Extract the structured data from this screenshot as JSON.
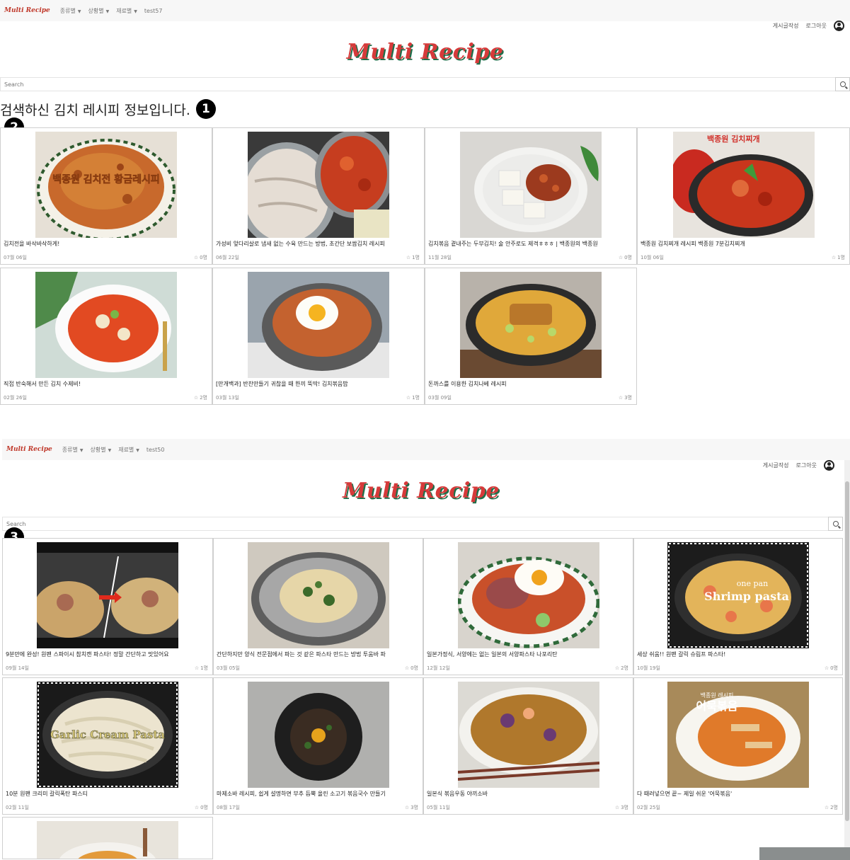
{
  "screen1": {
    "nav": {
      "brand": "Multi Recipe",
      "menu": [
        "종류별",
        "상황별",
        "재료별"
      ],
      "user": "test57"
    },
    "topright": {
      "write_label": "게시글작성",
      "logout_label": "로그아웃"
    },
    "logo": "Multi Recipe",
    "search": {
      "placeholder": "Search"
    },
    "result_heading": "검색하신 김치 레시피 정보입니다.",
    "markers": [
      "1",
      "2"
    ],
    "cards": [
      {
        "title": "김치전을 바삭바삭하게!",
        "date": "07월 06일",
        "likes": "0명"
      },
      {
        "title": "가성비 앞다리살로 냄새 없는 수육 만드는 방법, 초간단 보쌈김치 레시피",
        "date": "06월 22일",
        "likes": "1명"
      },
      {
        "title": "김치볶음 곁내주는 두부김치! 술 안주로도 제격ㅎㅎㅎ | 백종원의 백종원",
        "date": "11월 28일",
        "likes": "0명"
      },
      {
        "title": "백종원 김치찌개 레시피 백종원 7분김치찌개",
        "date": "10월 06일",
        "likes": "1명"
      },
      {
        "title": "직접 반숙해서 만든 김치 수제비!",
        "date": "02월 26일",
        "likes": "2명"
      },
      {
        "title": "[만개백과] 반찬만들기 귀찮을 때 한끼 뚝딱! 김치볶음밥",
        "date": "03월 13일",
        "likes": "1명"
      },
      {
        "title": "돈까스를 이용한 김치나베 레시피",
        "date": "03월 09일",
        "likes": "3명"
      }
    ]
  },
  "screen2": {
    "nav": {
      "brand": "Multi Recipe",
      "menu": [
        "종류별",
        "상황별",
        "재료별"
      ],
      "user": "test50"
    },
    "topright": {
      "write_label": "게시글작성",
      "logout_label": "로그아웃"
    },
    "logo": "Multi Recipe",
    "search": {
      "placeholder": "Search"
    },
    "markers": [
      "3"
    ],
    "cards": [
      {
        "title": "9분만에 완성! 원팬 스파이시 참치캔 파스타! 정말 간단하고 맛있어요",
        "date": "09월 14일",
        "likes": "1명"
      },
      {
        "title": "간단하지만 양식 전문점에서 파는 것 같은 파스타 만드는 방법 투움바 파",
        "date": "03월 05일",
        "likes": "0명"
      },
      {
        "title": "일본가정식, 서양에는 없는 일본의 서양파스타 나포리탄",
        "date": "12월 12일",
        "likes": "2명"
      },
      {
        "title": "세상 쉬움!! 원팬 갈릭 슈림프 파스타!",
        "date": "10월 19일",
        "likes": "0명"
      },
      {
        "title": "10분 원팬 크리미 갈릭폭탄 파스티",
        "date": "02월 11일",
        "likes": "0명"
      },
      {
        "title": "마제소바 레시피, 쉽게 설명하면 부추 듬뿍 올린 소고기 볶음국수 만들기",
        "date": "08월 17일",
        "likes": "3명"
      },
      {
        "title": "일본식 볶음우동 야끼소바",
        "date": "05월 11일",
        "likes": "3명"
      },
      {
        "title": "다 때려넣으면 끝~ 제일 쉬운 '어묵볶음'",
        "date": "02월 25일",
        "likes": "2명"
      },
      {
        "title": "",
        "date": "",
        "likes": ""
      }
    ]
  },
  "thumb_text": {
    "kimchijeon": "백종원 김치전 황금레시피",
    "stew_banner": "백종원 김치찌개",
    "shrimp1": "one pan",
    "shrimp2": "Shrimp pasta",
    "garlic": "Garlic Cream Pasta",
    "eomuk1": "백종원 레시피",
    "eomuk2": "어묵볶음"
  },
  "colors": {
    "logo_red": "#d63a3a",
    "logo_shadow": "#1f6e4a",
    "border": "#cfcfcf"
  }
}
